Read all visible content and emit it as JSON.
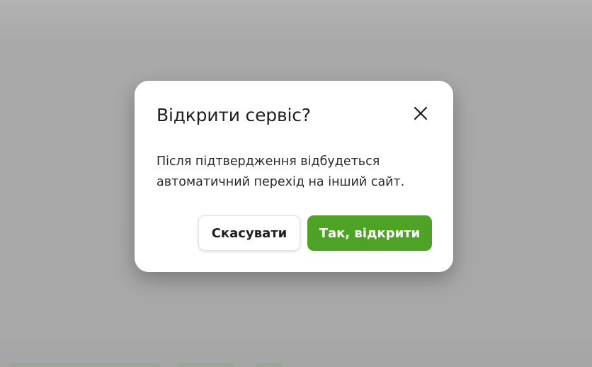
{
  "dialog": {
    "title": "Відкрити сервіс?",
    "message_line1": "Після підтвердження відбудеться",
    "message_line2": "автоматичний перехід на інший сайт.",
    "close_icon": "close-icon",
    "cancel_label": "Скасувати",
    "confirm_label": "Так, відкрити"
  },
  "colors": {
    "overlay": "#a8a8a8",
    "dialog_background": "#ffffff",
    "confirm_button": "#4ea327",
    "confirm_text": "#ffffff",
    "cancel_button": "#ffffff",
    "text": "#1f1f1f"
  }
}
